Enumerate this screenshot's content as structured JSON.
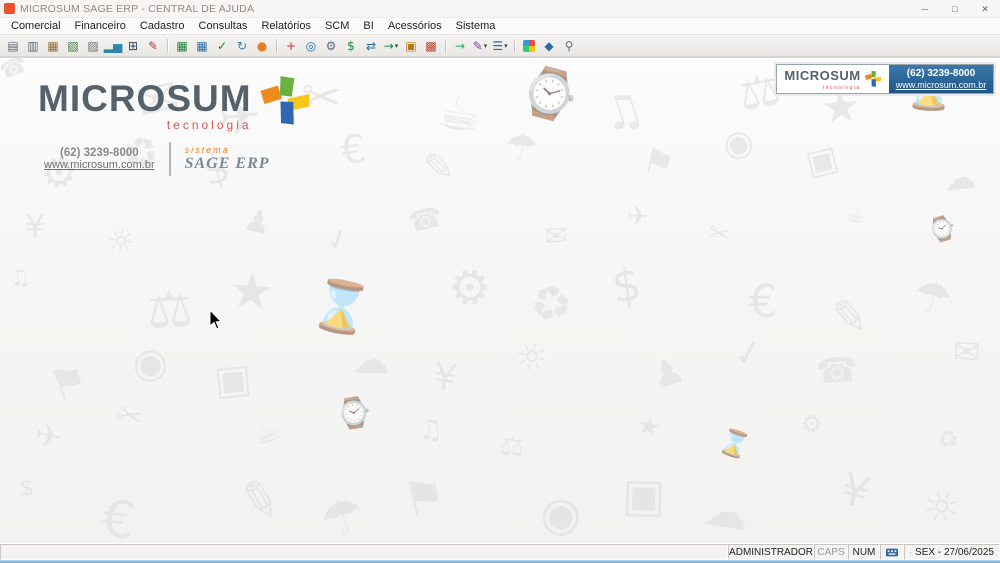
{
  "window": {
    "title": "MICROSUM SAGE ERP - CENTRAL DE AJUDA",
    "controls": {
      "minimize": "─",
      "maximize": "□",
      "close": "✕"
    }
  },
  "menu": {
    "items": [
      "Comercial",
      "Financeiro",
      "Cadastro",
      "Consultas",
      "Relatórios",
      "SCM",
      "BI",
      "Acessórios",
      "Sistema"
    ]
  },
  "toolbar": {
    "icons": [
      {
        "name": "printer-icon",
        "glyph": "▤",
        "color": "#5b6770"
      },
      {
        "name": "print-preview-icon",
        "glyph": "▥",
        "color": "#5b6770"
      },
      {
        "name": "help-book-icon",
        "glyph": "▦",
        "color": "#8a6d3b"
      },
      {
        "name": "notebook-icon",
        "glyph": "▧",
        "color": "#3f7a46"
      },
      {
        "name": "archive-icon",
        "glyph": "▨",
        "color": "#6d6d6d"
      },
      {
        "name": "chart-icon",
        "glyph": "▂▅",
        "color": "#2e86ab"
      },
      {
        "name": "calculator-icon",
        "glyph": "⊞",
        "color": "#34495e"
      },
      {
        "name": "report-pencil-icon",
        "glyph": "✎",
        "color": "#b03a2e"
      },
      {
        "type": "sep"
      },
      {
        "name": "green-ledger-icon",
        "glyph": "▦",
        "color": "#27813b"
      },
      {
        "name": "table-grid-icon",
        "glyph": "▦",
        "color": "#2e6da4"
      },
      {
        "name": "document-check-icon",
        "glyph": "✓",
        "color": "#27813b"
      },
      {
        "name": "refresh-icon",
        "glyph": "↻",
        "color": "#2e86ab"
      },
      {
        "name": "fireball-icon",
        "glyph": "●",
        "color": "#e67e22"
      },
      {
        "type": "sep"
      },
      {
        "name": "tools-red-icon",
        "glyph": "+",
        "color": "#c0392b"
      },
      {
        "name": "globe-icon",
        "glyph": "◎",
        "color": "#2471a3"
      },
      {
        "name": "gear-icon",
        "glyph": "⚙",
        "color": "#5d6d7e"
      },
      {
        "name": "money-dollar-icon",
        "glyph": "$",
        "color": "#1e8449"
      },
      {
        "name": "sync-arrows-icon",
        "glyph": "⇄",
        "color": "#2471a3"
      },
      {
        "name": "transfer-money-icon",
        "glyph": "→",
        "color": "#1e8449",
        "dropdown": true
      },
      {
        "name": "package-box-icon",
        "glyph": "▣",
        "color": "#b9770e"
      },
      {
        "name": "gift-icon",
        "glyph": "▩",
        "color": "#c0392b"
      },
      {
        "type": "sep"
      },
      {
        "name": "run-arrow-icon",
        "glyph": "→",
        "color": "#27ae60"
      },
      {
        "name": "design-tools-icon",
        "glyph": "✎",
        "color": "#7d3c98",
        "dropdown": true
      },
      {
        "name": "blue-list-icon",
        "glyph": "☰",
        "color": "#2471a3",
        "dropdown": true
      },
      {
        "type": "sep"
      },
      {
        "name": "window-colored-icon",
        "glyph": "",
        "color": "",
        "quad": true
      },
      {
        "name": "shield-icon",
        "glyph": "◆",
        "color": "#2e6da4"
      },
      {
        "name": "search-gear-icon",
        "glyph": "⚲",
        "color": "#5d6d7e"
      }
    ]
  },
  "branding": {
    "logo_text": "MICROSUM",
    "logo_subtext": "tecnologia",
    "phone": "(62) 3239-8000",
    "website": "www.microsum.com.br",
    "system_label": "sistema",
    "system_name": "SAGE ERP"
  },
  "header_badge": {
    "logo_text": "MICROSUM",
    "logo_subtext": "tecnologia",
    "phone": "(62) 3239-8000",
    "website": "www.microsum.com.br"
  },
  "statusbar": {
    "user": "ADMINISTRADOR",
    "caps": "CAPS",
    "num": "NUM",
    "date": "SEX - 27/06/2025"
  },
  "watermark": {
    "glyphs": [
      "☎",
      "✉",
      "✈",
      "✂",
      "☕",
      "⌚",
      "♫",
      "⚖",
      "★",
      "⌛",
      "⚙",
      "♻",
      "$",
      "€",
      "✎",
      "☂",
      "⚑",
      "◉",
      "▣",
      "☁",
      "¥",
      "☼",
      "♟",
      "✓"
    ]
  }
}
